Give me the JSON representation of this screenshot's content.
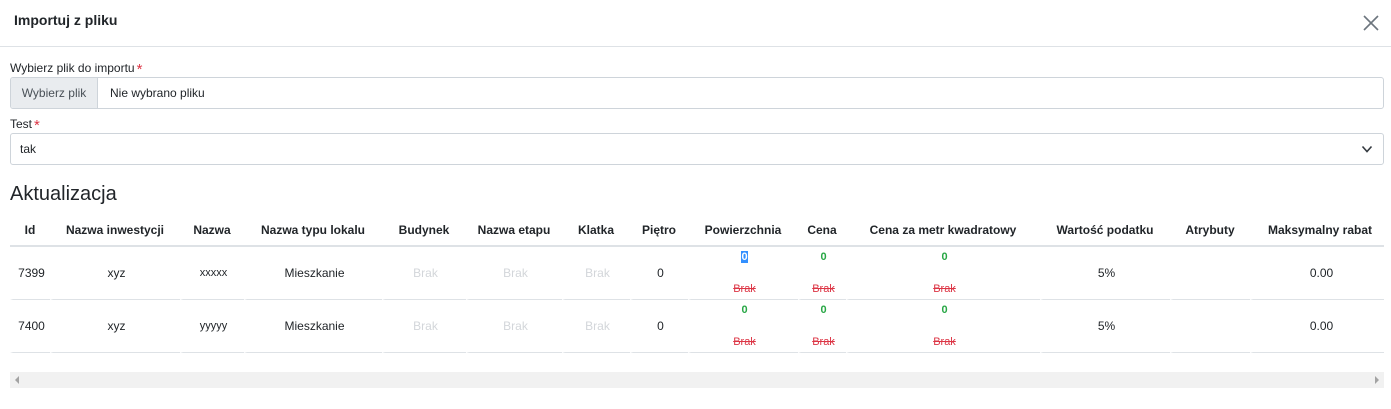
{
  "modal": {
    "title": "Importuj z pliku",
    "close_icon": "close-icon"
  },
  "file_field": {
    "label": "Wybierz plik do importu",
    "required_mark": "*",
    "button_label": "Wybierz plik",
    "file_name": "Nie wybrano pliku"
  },
  "test_field": {
    "label": "Test",
    "required_mark": "*",
    "selected": "tak"
  },
  "section": {
    "title": "Aktualizacja"
  },
  "table": {
    "columns": [
      "Id",
      "Nazwa inwestycji",
      "Nazwa",
      "Nazwa typu lokalu",
      "Budynek",
      "Nazwa etapu",
      "Klatka",
      "Piętro",
      "Powierzchnia",
      "Cena",
      "Cena za metr kwadratowy",
      "Wartość podatku",
      "Atrybuty",
      "Maksymalny rabat"
    ],
    "rows": [
      {
        "id": "7399",
        "investment": "xyz",
        "name": "xxxxx",
        "type": "Mieszkanie",
        "building": "Brak",
        "stage": "Brak",
        "staircase": "Brak",
        "floor": "0",
        "area_new": "0",
        "area_old": "Brak",
        "price_new": "0",
        "price_old": "Brak",
        "ppm_new": "0",
        "ppm_old": "Brak",
        "tax": "5%",
        "attributes": "",
        "max_discount": "0.00"
      },
      {
        "id": "7400",
        "investment": "xyz",
        "name": "yyyyy",
        "type": "Mieszkanie",
        "building": "Brak",
        "stage": "Brak",
        "staircase": "Brak",
        "floor": "0",
        "area_new": "0",
        "area_old": "Brak",
        "price_new": "0",
        "price_old": "Brak",
        "ppm_new": "0",
        "ppm_old": "Brak",
        "tax": "5%",
        "attributes": "",
        "max_discount": "0.00"
      }
    ]
  },
  "colors": {
    "required": "#dc3545",
    "new_value": "#28a745",
    "old_value": "#dc3545",
    "selection": "#3390ff"
  }
}
